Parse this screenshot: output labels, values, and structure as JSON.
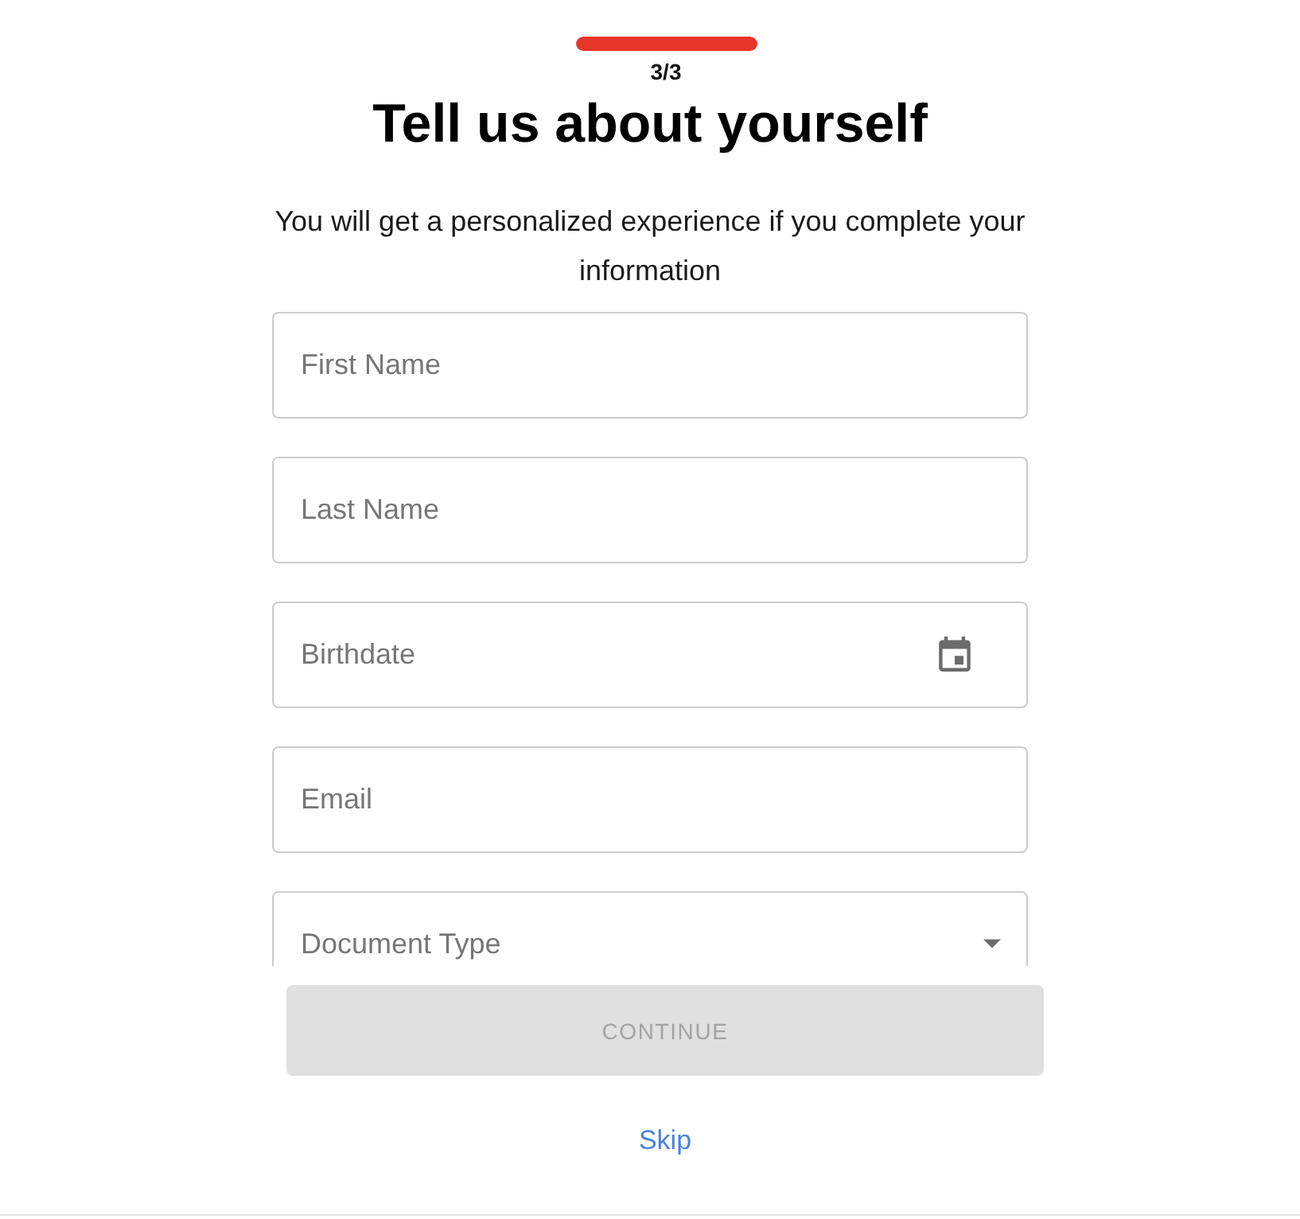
{
  "progress": {
    "level": 1,
    "step": "3/3"
  },
  "title": "Tell us about yourself",
  "subtitle": "You will get a personalized experience if you complete your information",
  "fields": [
    {
      "kind": "text",
      "placeholder": "First Name"
    },
    {
      "kind": "text",
      "placeholder": "Last Name"
    },
    {
      "kind": "date",
      "placeholder": "Birthdate"
    },
    {
      "kind": "text",
      "placeholder": "Email"
    },
    {
      "kind": "select",
      "placeholder": "Document Type"
    }
  ],
  "continue_button": {
    "label": "CONTINUE",
    "disabled": true
  },
  "skip_link": {
    "label": "Skip"
  }
}
